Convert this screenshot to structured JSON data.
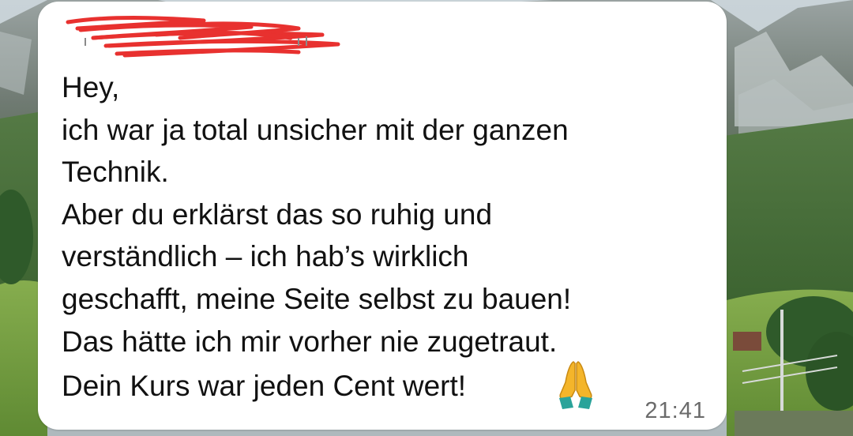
{
  "message": {
    "lines": [
      "Hey,",
      "ich war ja total unsicher mit der ganzen",
      "Technik.",
      "Aber du erklärst das so ruhig und",
      "verständlich – ich hab’s wirklich",
      "geschafft, meine Seite selbst zu bauen!",
      "Das hätte ich mir vorher nie zugetraut."
    ],
    "last_line": "Dein Kurs war jeden Cent wert!",
    "emoji": "folded-hands-icon",
    "time": "21:41"
  },
  "colors": {
    "bubble": "#ffffff",
    "text": "#111111",
    "time": "#6b6b6b",
    "redaction": "#e8312f",
    "emoji_skin": "#f4b52a"
  }
}
